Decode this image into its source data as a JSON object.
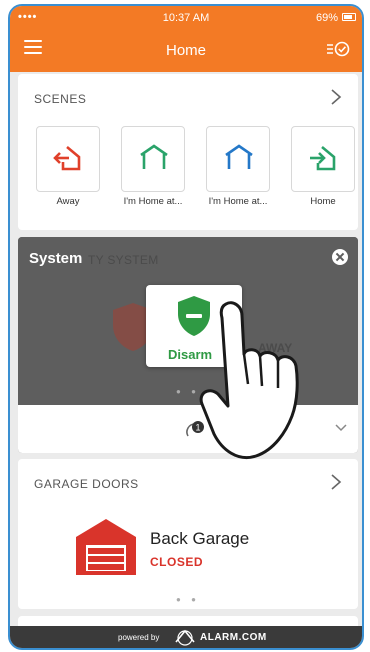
{
  "status_bar": {
    "time": "10:37 AM",
    "battery": "69%",
    "signal": "••••"
  },
  "header": {
    "title": "Home"
  },
  "scenes": {
    "title": "SCENES",
    "items": [
      {
        "label": "Away",
        "color": "#e0402a"
      },
      {
        "label": "I'm Home at...",
        "color": "#2aa36a"
      },
      {
        "label": "I'm Home at...",
        "color": "#2478c8"
      },
      {
        "label": "Home",
        "color": "#2aa36a"
      }
    ]
  },
  "system": {
    "label": "System",
    "faded_title": "TY SYSTEM",
    "faded_away": "AWAY",
    "disarmed_label": "Disarm",
    "dots": "● ●",
    "sync_badge": "1"
  },
  "garage": {
    "title": "GARAGE DOORS",
    "door_name": "Back Garage",
    "door_status": "CLOSED",
    "dots": "● ●"
  },
  "footer": {
    "powered": "powered by",
    "brand": "ALARM.COM"
  },
  "colors": {
    "accent": "#f37a25",
    "disarmed": "#2f9a44",
    "closed": "#d9342b"
  }
}
